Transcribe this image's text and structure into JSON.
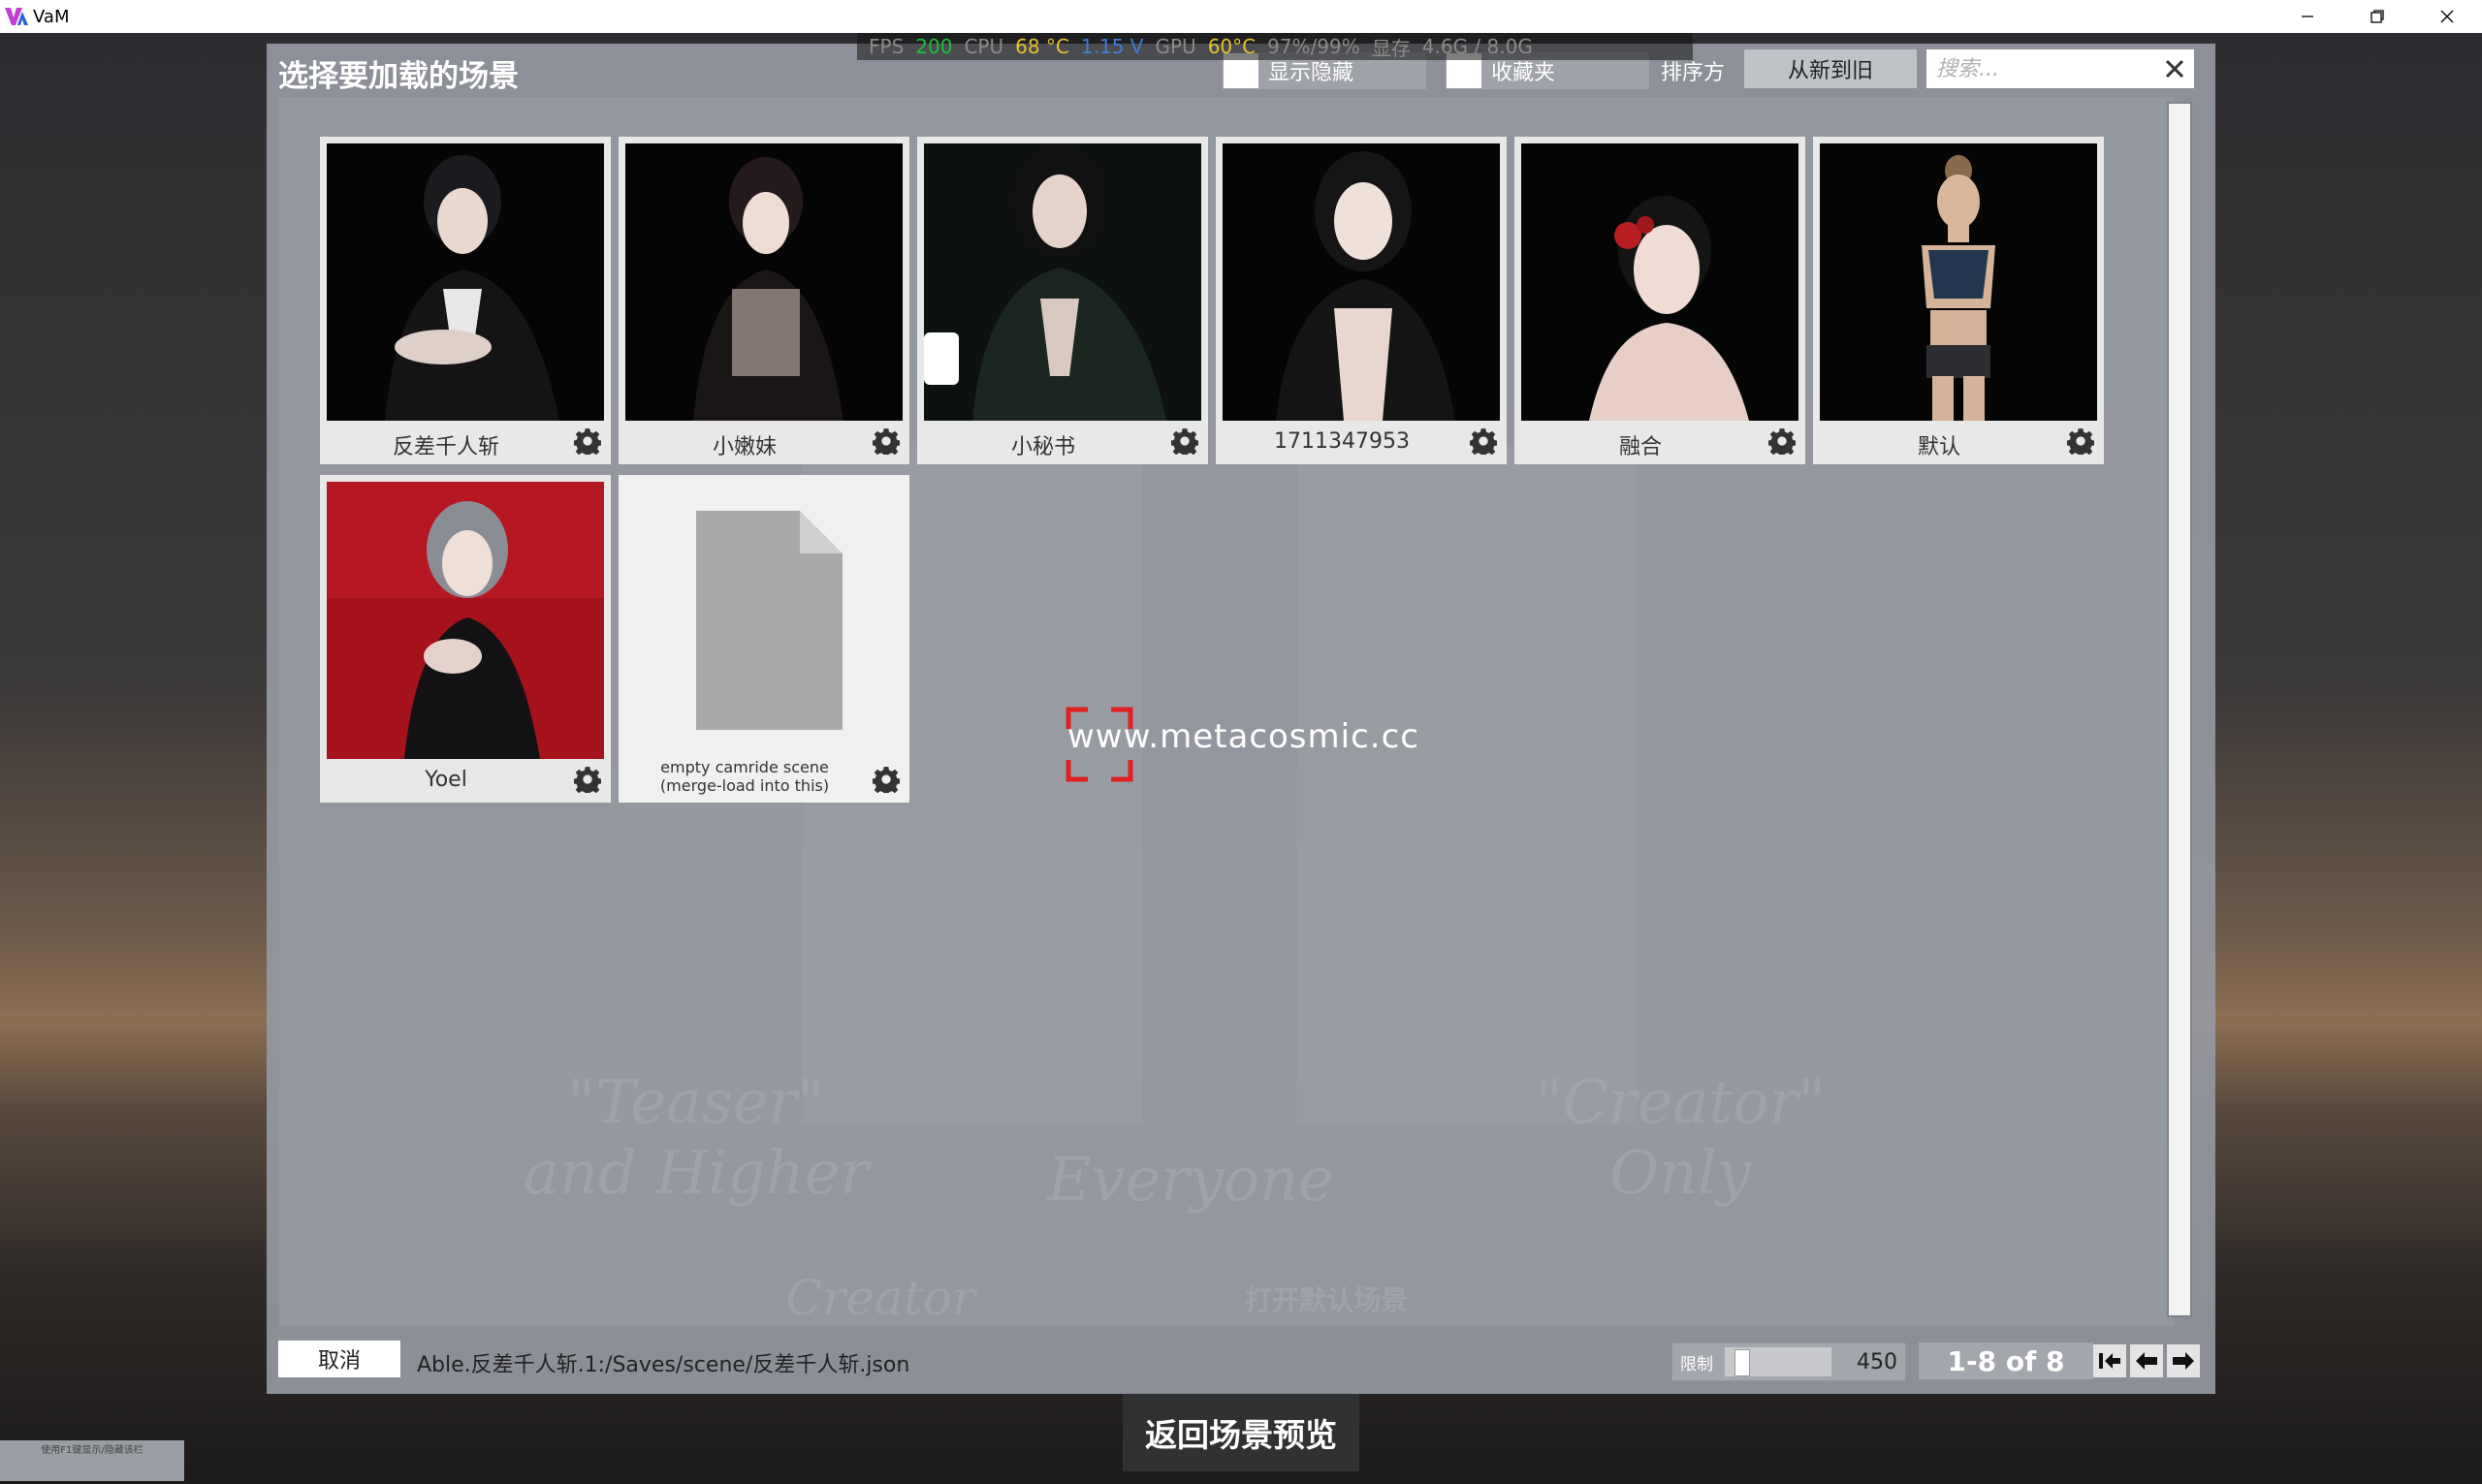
{
  "window": {
    "title": "VaM",
    "minimize_icon": "minimize-icon",
    "restore_icon": "restore-icon",
    "close_icon": "close-icon"
  },
  "perf": {
    "fps_label": "FPS",
    "fps_value": "200",
    "cpu_label": "CPU",
    "cpu_temp": "68 °C",
    "cpu_voltage": "1.15 V",
    "gpu_label": "GPU",
    "gpu_temp": "60°C",
    "gpu_usage": "97%/99%",
    "mem_label": "显存",
    "mem_value": "4.6G / 8.0G"
  },
  "dialog": {
    "title": "选择要加载的场景",
    "show_hidden_label": "显示隐藏",
    "favorites_label": "收藏夹",
    "sort_label": "排序方",
    "sort_value": "从新到旧",
    "search_placeholder": "搜索..."
  },
  "tiles": [
    {
      "name": "反差千人斩"
    },
    {
      "name": "小嫩妹"
    },
    {
      "name": "小秘书"
    },
    {
      "name": "1711347953"
    },
    {
      "name": "融合"
    },
    {
      "name": "默认"
    },
    {
      "name": "Yoel"
    },
    {
      "name_line1": "empty camride scene",
      "name_line2": "(merge-load into this)"
    }
  ],
  "background_text": {
    "left": "\"Teaser\"",
    "left2": "and Higher",
    "center": "Everyone",
    "right": "\"Creator\"",
    "right2": "Only",
    "bottom_left": "Creator",
    "bottom_center": "打开默认场景"
  },
  "overlay": {
    "url": "www.metacosmic.cc"
  },
  "footer": {
    "cancel_label": "取消",
    "path": "Able.反差千人斩.1:/Saves/scene/反差千人斩.json",
    "limit_label": "限制",
    "limit_value": "450",
    "limit_fraction": 0.05,
    "page_info": "1-8 of 8"
  },
  "return_button": "返回场景预览",
  "hint": "使用F1键显示/隐藏该栏",
  "colors": {
    "dialog_bg": "#94989f",
    "accent_red": "#e02020",
    "title_text": "#ffffff"
  }
}
